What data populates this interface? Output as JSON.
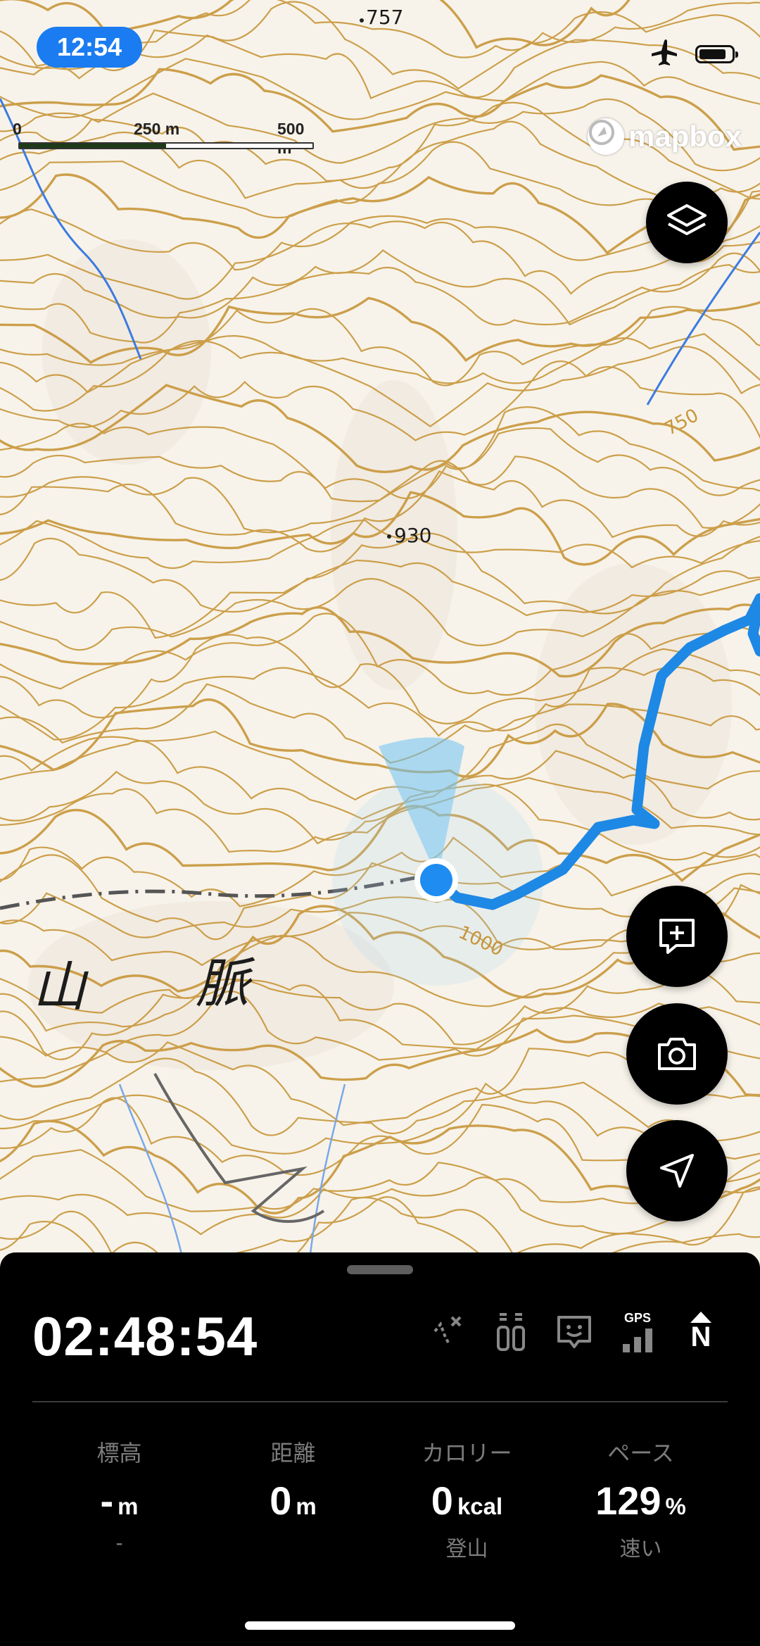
{
  "status_bar": {
    "time": "12:54",
    "icons": [
      "airplane-mode-icon",
      "battery-icon"
    ],
    "battery_level": 0.85
  },
  "map": {
    "scale_labels": [
      "0",
      "250 m",
      "500 m"
    ],
    "attribution": "mapbox",
    "elevation_labels": [
      "757",
      "930",
      "750",
      "1000"
    ],
    "place_labels": [
      "山",
      "脈"
    ],
    "colors": {
      "contour": "#c8963a",
      "background": "#f7f3ea",
      "route": "#1e88e5",
      "stream": "#3c7be0",
      "location_dot": "#1e8cf0",
      "ridge_path": "#666666"
    }
  },
  "controls": {
    "layers_icon": "layers-icon",
    "add_note_icon": "add-note-icon",
    "camera_icon": "camera-icon",
    "locate_icon": "navigation-arrow-icon"
  },
  "panel": {
    "elapsed_time": "02:48:54",
    "indicators": [
      "route-off-icon",
      "water-gauge-icon",
      "face-icon",
      "gps-signal-icon",
      "north-compass-icon"
    ],
    "gps_label": "GPS",
    "compass_label": "N",
    "stats": {
      "altitude": {
        "label": "標高",
        "value": "-",
        "unit": "m",
        "sub": "-"
      },
      "distance": {
        "label": "距離",
        "value": "0",
        "unit": "m",
        "sub": ""
      },
      "calories": {
        "label": "カロリー",
        "value": "0",
        "unit": "kcal",
        "sub": "登山"
      },
      "pace": {
        "label": "ペース",
        "value": "129",
        "unit": "%",
        "sub": "速い"
      }
    }
  }
}
